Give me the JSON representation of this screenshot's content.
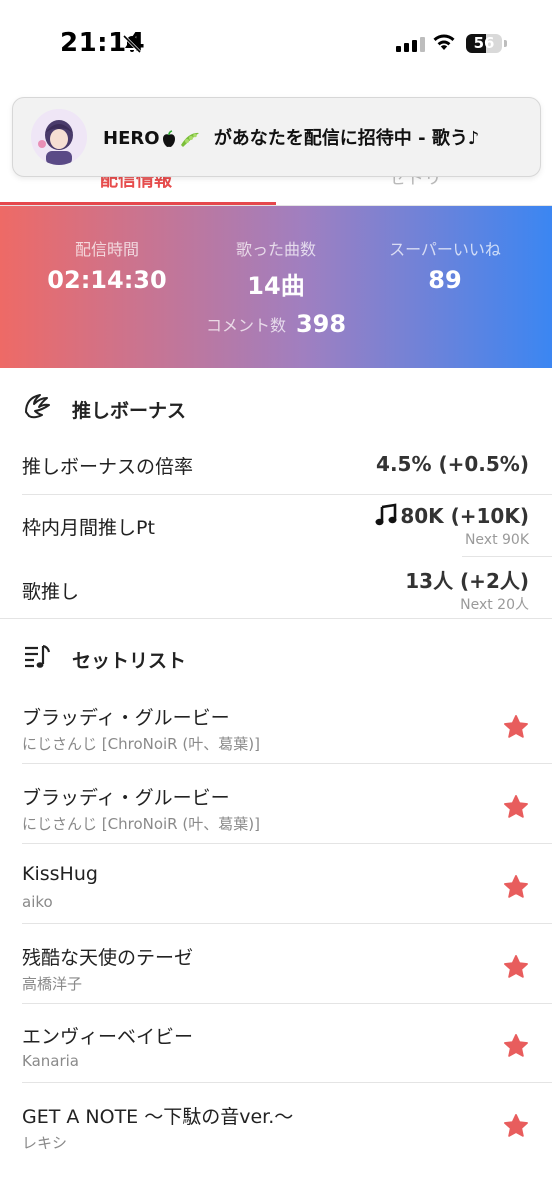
{
  "status_bar": {
    "time": "21:14",
    "battery": "56"
  },
  "tabs": {
    "left": "配信情報",
    "right": "セトリ"
  },
  "notification": {
    "name": "HERO",
    "message": "があなたを配信に招待中 - 歌う♪"
  },
  "stats": {
    "stream_time_label": "配信時間",
    "stream_time": "02:14:30",
    "songs_label": "歌った曲数",
    "songs": "14曲",
    "superlike_label": "スーパーいいね",
    "superlike": "89",
    "comments_label": "コメント数",
    "comments": "398"
  },
  "oshi_bonus": {
    "title": "推しボーナス",
    "rows": [
      {
        "label": "推しボーナスの倍率",
        "value": "4.5% (+0.5%)",
        "sub": ""
      },
      {
        "label": "枠内月間推しPt",
        "value": "80K (+10K)",
        "sub": "Next 90K"
      },
      {
        "label": "歌推し",
        "value": "13人 (+2人)",
        "sub": "Next 20人"
      }
    ]
  },
  "setlist": {
    "title": "セットリスト",
    "songs": [
      {
        "title": "ブラッディ・グルービー",
        "artist": "にじさんじ [ChroNoiR (叶、葛葉)]"
      },
      {
        "title": "ブラッディ・グルービー",
        "artist": "にじさんじ [ChroNoiR (叶、葛葉)]"
      },
      {
        "title": "KissHug",
        "artist": "aiko"
      },
      {
        "title": "残酷な天使のテーゼ",
        "artist": "高橋洋子"
      },
      {
        "title": "エンヴィーベイビー",
        "artist": "Kanaria"
      },
      {
        "title": "GET A NOTE 〜下駄の音ver.〜",
        "artist": "レキシ"
      }
    ]
  },
  "colors": {
    "accent": "#e5484d",
    "star": "#e85d5d",
    "gradient_start": "#ee6a66",
    "gradient_end": "#3b86f2"
  }
}
